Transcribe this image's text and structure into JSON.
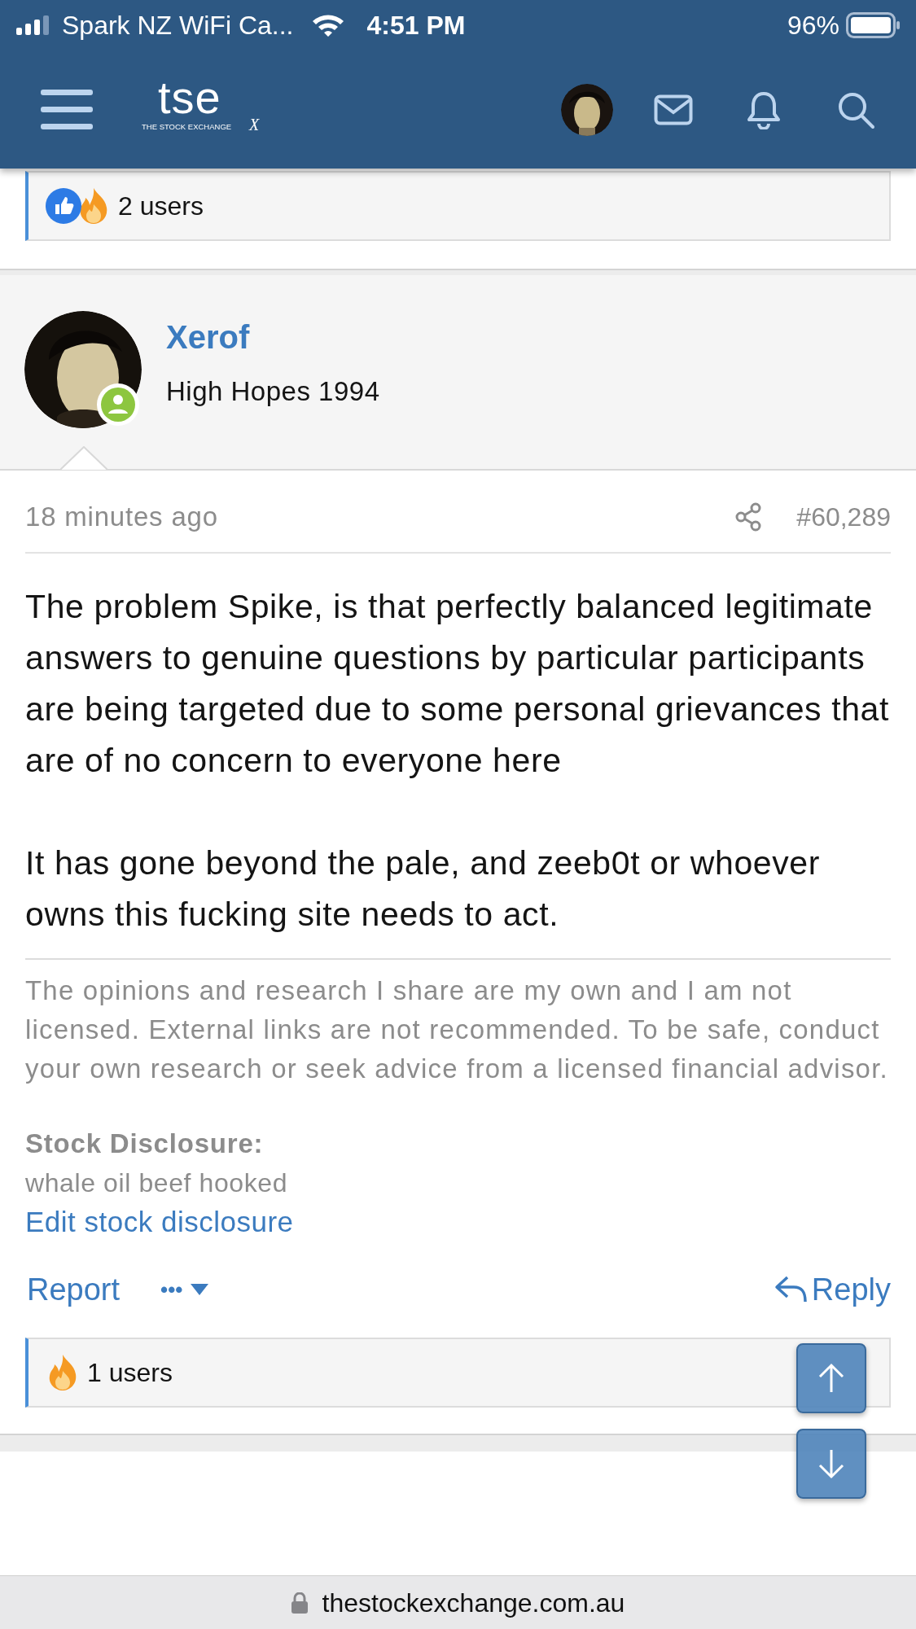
{
  "status_bar": {
    "carrier": "Spark NZ WiFi Ca...",
    "time": "4:51 PM",
    "battery": "96%"
  },
  "nav": {
    "logo": "tse",
    "logo_tagline": "THE STOCK EXCHANGE",
    "logo_mark": "X"
  },
  "top_reactions": {
    "text": "2 users",
    "icons": [
      {
        "kind": "like"
      },
      {
        "kind": "fire"
      }
    ]
  },
  "post": {
    "author": "Xerof",
    "user_title": "High Hopes 1994",
    "online": true,
    "time": "18 minutes ago",
    "number": "#60,289",
    "paragraphs": [
      "The problem Spike, is that perfectly balanced legitimate answers to genuine questions by particular participants are being targeted due to some personal grievances that are of no concern to everyone here",
      "It has gone beyond the pale, and zeeb0t or whoever owns this fucking site needs to act."
    ],
    "signature": "The opinions and research I share are my own and I am not licensed. External links are not recommended. To be safe, conduct your own research or seek advice from a licensed financial advisor.",
    "disclosure_label": "Stock Disclosure:",
    "disclosure_text": "whale oil beef hooked",
    "disclosure_link": "Edit stock disclosure",
    "actions": {
      "report": "Report",
      "more": "•••",
      "reply": "Reply"
    },
    "reactions": {
      "text": "1 users",
      "icons": [
        {
          "kind": "fire"
        }
      ]
    }
  },
  "url_bar": {
    "url": "thestockexchange.com.au"
  }
}
